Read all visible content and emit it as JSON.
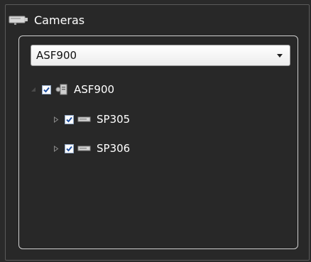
{
  "panel": {
    "title": "Cameras",
    "title_icon": "camera-icon"
  },
  "dropdown": {
    "selected": "ASF900",
    "arrow_icon": "chevron-down-icon"
  },
  "tree": {
    "root": {
      "label": "ASF900",
      "checked": true,
      "expanded": true,
      "icon": "server-icon"
    },
    "children": [
      {
        "label": "SP305",
        "checked": true,
        "expanded": false,
        "icon": "device-icon"
      },
      {
        "label": "SP306",
        "checked": true,
        "expanded": false,
        "icon": "device-icon"
      }
    ]
  },
  "colors": {
    "background": "#282828",
    "text": "#ffffff",
    "checkbox_check": "#1f4fa0"
  }
}
